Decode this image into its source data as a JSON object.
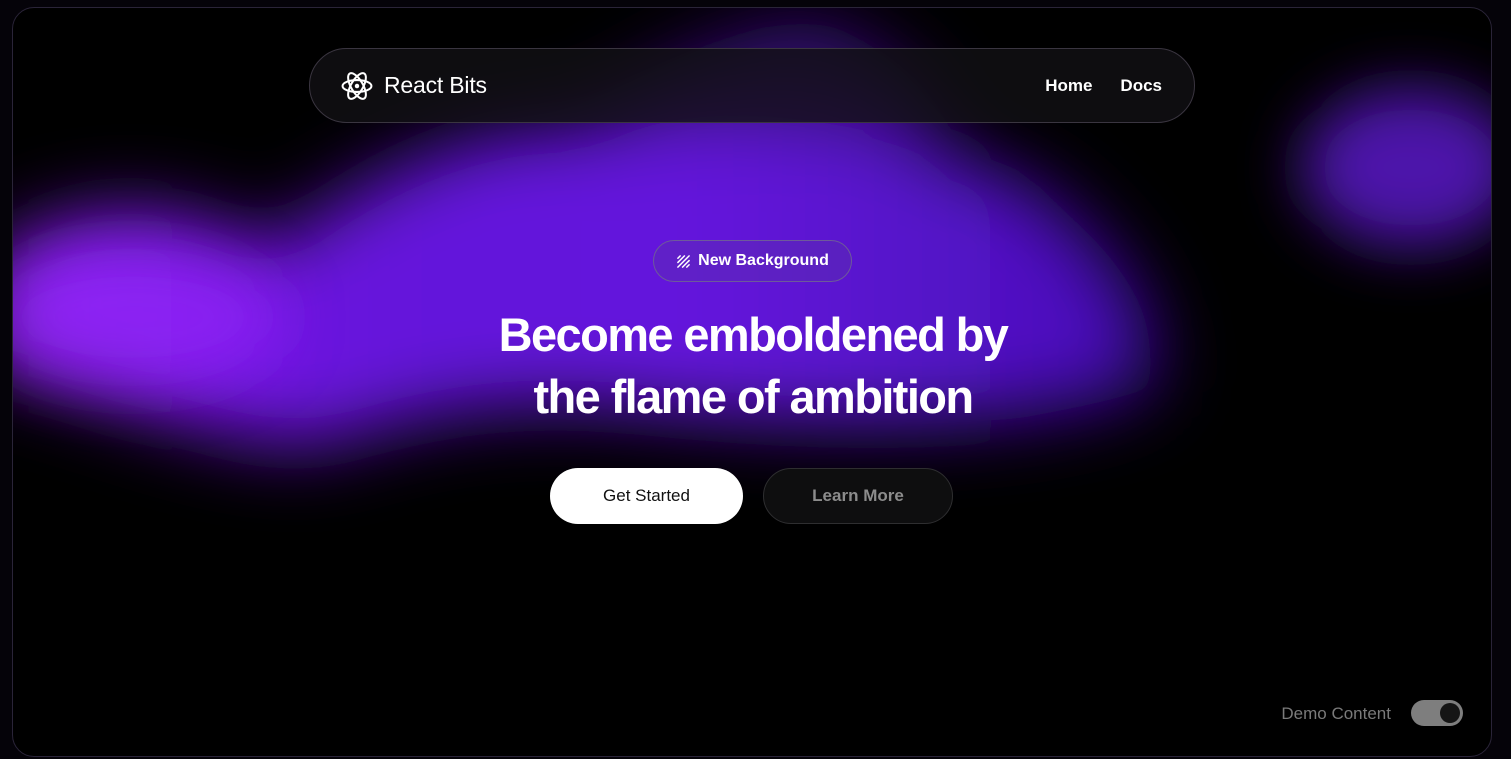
{
  "brand": {
    "name": "React Bits",
    "logo_icon": "atom-icon"
  },
  "nav": {
    "links": [
      {
        "label": "Home"
      },
      {
        "label": "Docs"
      }
    ]
  },
  "hero": {
    "badge": {
      "icon": "diagonal-stripes-icon",
      "label": "New Background"
    },
    "title_lines": [
      "Become emboldened by",
      "the flame of ambition"
    ],
    "primary_button": "Get Started",
    "secondary_button": "Learn More"
  },
  "demo_toggle": {
    "label": "Demo Content",
    "state": "on"
  },
  "colors": {
    "accent_purple": "#7a1bf2",
    "background": "#000000",
    "primary_button_bg": "#ffffff",
    "toggle_track": "#7e7e7e"
  }
}
